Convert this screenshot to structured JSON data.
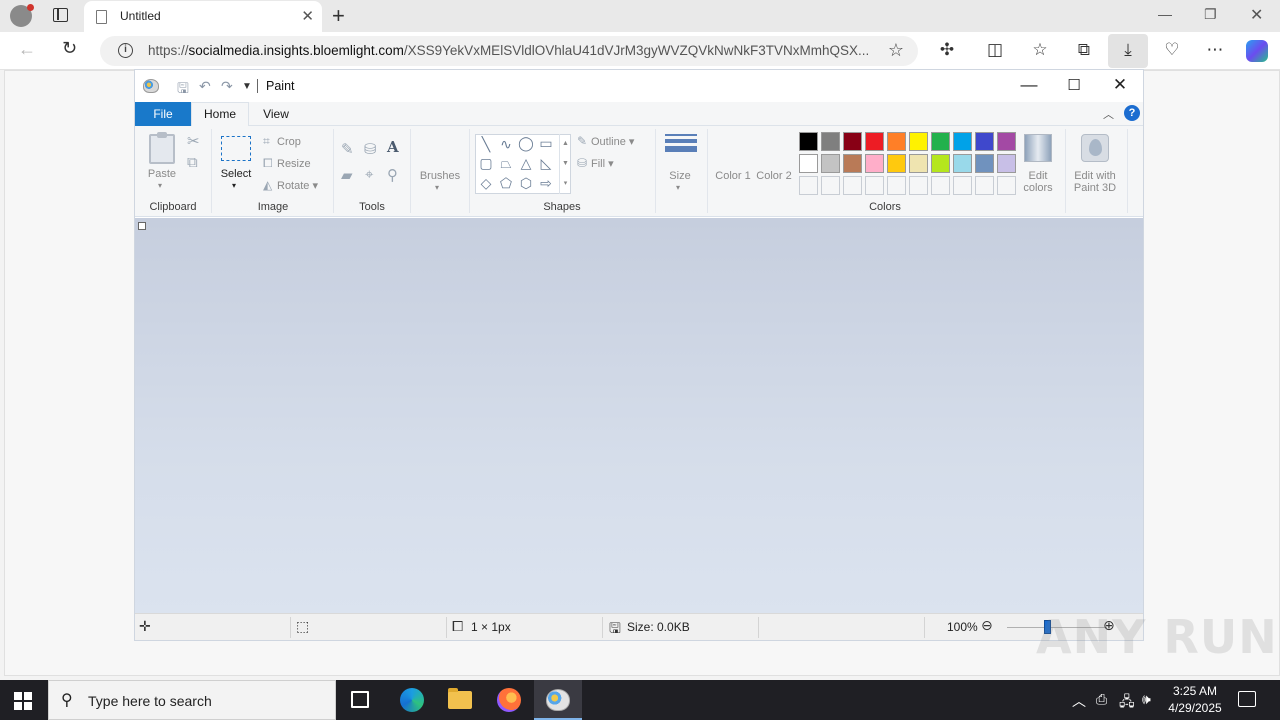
{
  "browser": {
    "tab_title": "Untitled",
    "url_prefix": "https://",
    "url_domain": "socialmedia.insights.bloemlight.com",
    "url_path": "/XSS9YekVxMElSVldlOVhlaU41dVJrM3gyWVZQVkNwNkF3TVNxMmhQSX..."
  },
  "paint": {
    "title": "Paint",
    "tabs": {
      "file": "File",
      "home": "Home",
      "view": "View"
    },
    "clipboard": {
      "paste": "Paste",
      "label": "Clipboard"
    },
    "image": {
      "select": "Select",
      "crop": "Crop",
      "resize": "Resize",
      "rotate": "Rotate",
      "label": "Image"
    },
    "tools": {
      "label": "Tools"
    },
    "brushes": {
      "label": "Brushes"
    },
    "shapes": {
      "outline": "Outline",
      "fill": "Fill",
      "label": "Shapes"
    },
    "size": {
      "label": "Size"
    },
    "colors": {
      "color1": "Color 1",
      "color2": "Color 2",
      "edit_colors": "Edit colors",
      "edit_3d": "Edit with Paint 3D",
      "label": "Colors",
      "row1": [
        "#000000",
        "#7f7f7f",
        "#880015",
        "#ed1c24",
        "#ff7f27",
        "#fff200",
        "#22b14c",
        "#00a2e8",
        "#3f48cc",
        "#a349a4"
      ],
      "row2": [
        "#ffffff",
        "#c3c3c3",
        "#b97a57",
        "#ffaec9",
        "#ffc90e",
        "#efe4b0",
        "#b5e61d",
        "#99d9ea",
        "#7092be",
        "#c8bfe7"
      ]
    },
    "status": {
      "dimensions": "1 × 1px",
      "size": "Size: 0.0KB",
      "zoom": "100%",
      "zoom_level": 1.0
    }
  },
  "taskbar": {
    "search_placeholder": "Type here to search",
    "time": "3:25 AM",
    "date": "4/29/2025"
  },
  "watermark": "ANY RUN"
}
